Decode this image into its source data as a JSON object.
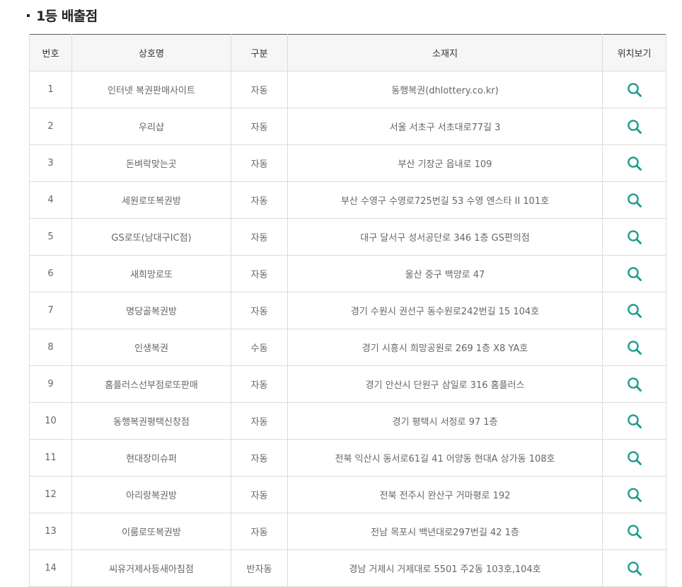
{
  "section": {
    "title": "1등 배출점"
  },
  "table": {
    "headers": {
      "no": "번호",
      "name": "상호명",
      "type": "구분",
      "address": "소재지",
      "location": "위치보기"
    },
    "rows": [
      {
        "no": "1",
        "name": "인터넷 복권판매사이트",
        "type": "자동",
        "address": "동행복권(dhlottery.co.kr)"
      },
      {
        "no": "2",
        "name": "우리샵",
        "type": "자동",
        "address": "서울 서초구 서초대로77길 3"
      },
      {
        "no": "3",
        "name": "돈벼락맞는곳",
        "type": "자동",
        "address": "부산 기장군 읍내로 109"
      },
      {
        "no": "4",
        "name": "세원로또복권방",
        "type": "자동",
        "address": "부산 수영구 수영로725번길 53 수영 엔스타 II  101호"
      },
      {
        "no": "5",
        "name": "GS로또(남대구IC점)",
        "type": "자동",
        "address": "대구 달서구 성서공단로 346 1층 GS편의점"
      },
      {
        "no": "6",
        "name": "새희망로또",
        "type": "자동",
        "address": "울산 중구 백양로 47"
      },
      {
        "no": "7",
        "name": "명당골복권방",
        "type": "자동",
        "address": "경기 수원시 권선구 동수원로242번길 15 104호"
      },
      {
        "no": "8",
        "name": "인생복권",
        "type": "수동",
        "address": "경기 시흥시 희망공원로 269 1층 X8 YA호"
      },
      {
        "no": "9",
        "name": "홈플러스선부점로또판매",
        "type": "자동",
        "address": "경기 안산시 단원구 삼일로 316 홈플러스"
      },
      {
        "no": "10",
        "name": "동행복권평택신창점",
        "type": "자동",
        "address": "경기 평택시 서정로 97 1층"
      },
      {
        "no": "11",
        "name": "현대장미슈퍼",
        "type": "자동",
        "address": "전북 익산시 동서로61길 41 어양동 현대A 상가동 108호"
      },
      {
        "no": "12",
        "name": "아리랑복권방",
        "type": "자동",
        "address": "전북 전주시 완산구 거마평로 192"
      },
      {
        "no": "13",
        "name": "이룸로또복권방",
        "type": "자동",
        "address": "전남 목포시 백년대로297번길 42 1층"
      },
      {
        "no": "14",
        "name": "씨유거제사등새아침점",
        "type": "반자동",
        "address": "경남 거제시 거제대로 5501 주2동 103호,104호"
      }
    ]
  },
  "colors": {
    "search_icon": "#1a9a8a",
    "header_bg": "#f6f6f6",
    "border": "#dcdcdc"
  },
  "icons": {
    "location": "search-icon"
  }
}
